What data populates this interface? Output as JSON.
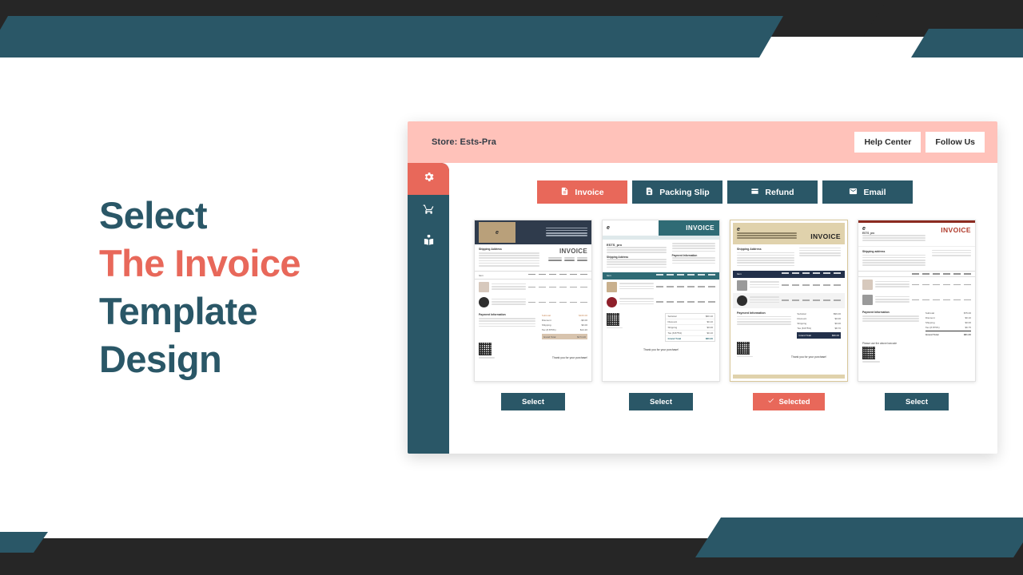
{
  "headline": {
    "line1": "Select",
    "line2": "The Invoice",
    "line3": "Template",
    "line4": "Design"
  },
  "colors": {
    "teal": "#2A5767",
    "coral": "#E8685A",
    "pink_band": "#FFC2BA",
    "charcoal": "#262626",
    "tan": "#E0D2AC",
    "navy": "#22304A",
    "maroon": "#8B2B20"
  },
  "app": {
    "topbar": {
      "store_label": "Store: Ests-Pra",
      "help_center": "Help Center",
      "follow_us": "Follow Us"
    },
    "sidebar": {
      "items": [
        {
          "icon": "gear-icon",
          "active": true
        },
        {
          "icon": "cart-icon",
          "active": false
        },
        {
          "icon": "book-icon",
          "active": false
        }
      ]
    },
    "tabs": [
      {
        "label": "Invoice",
        "icon": "document-icon",
        "active": true
      },
      {
        "label": "Packing Slip",
        "icon": "packing-slip-icon",
        "active": false
      },
      {
        "label": "Refund",
        "icon": "refund-icon",
        "active": false
      },
      {
        "label": "Email",
        "icon": "envelope-icon",
        "active": false
      }
    ],
    "templates": [
      {
        "name": "dark-navy-header",
        "button_label": "Select",
        "selected": false,
        "heading": "INVOICE",
        "store": "ESTS_pro",
        "section_shipping": "Shipping Address",
        "section_payment": "Payment Information",
        "thanks": "Thank you for your purchase!",
        "table_headers": [
          "Item",
          "Qty",
          "Price",
          "Discount",
          "Tax",
          "Tax Amount",
          "Subtotal"
        ],
        "totals": [
          {
            "label": "Subtotal",
            "value": "$160.00"
          },
          {
            "label": "Discount",
            "value": "-$0.00"
          },
          {
            "label": "Shipping",
            "value": "$0.00"
          },
          {
            "label": "Tax (8.875%)",
            "value": "$14.20"
          },
          {
            "label": "Grand Total",
            "value": "$174.20"
          }
        ]
      },
      {
        "name": "teal-banner",
        "button_label": "Select",
        "selected": false,
        "heading": "INVOICE",
        "store": "ESTS_pro",
        "section_shipping": "Shipping Address",
        "section_payment": "Payment Information",
        "thanks": "Thank you for your purchase!",
        "table_headers": [
          "Item",
          "Qty",
          "Price",
          "Discount",
          "Tax",
          "Tax Amount",
          "Subtotal"
        ],
        "totals": [
          {
            "label": "Subtotal",
            "value": "$60.10"
          },
          {
            "label": "Discount",
            "value": "$0.10"
          },
          {
            "label": "Shipping",
            "value": "$0.00"
          },
          {
            "label": "Tax (8.875%)",
            "value": "$0.10"
          },
          {
            "label": "Grand Total",
            "value": "$60.00"
          }
        ]
      },
      {
        "name": "tan-header",
        "button_label": "Selected",
        "selected": true,
        "heading": "INVOICE",
        "store": "ESTS_pro",
        "section_shipping": "Shipping Address",
        "section_payment": "Payment Information",
        "thanks": "Thank you for your purchase!",
        "table_headers": [
          "Item",
          "Qty",
          "Price",
          "Discount",
          "Tax",
          "Tax Amount",
          "Subtotal"
        ],
        "totals": [
          {
            "label": "Subtotal",
            "value": "$96.00"
          },
          {
            "label": "Discount",
            "value": "$0.00"
          },
          {
            "label": "Shipping",
            "value": "$0.00"
          },
          {
            "label": "Tax (8.875%)",
            "value": "$8.70"
          },
          {
            "label": "Grand Total",
            "value": "$96.00"
          }
        ]
      },
      {
        "name": "red-accent",
        "button_label": "Select",
        "selected": false,
        "heading": "INVOICE",
        "store": "ESTS_pro",
        "section_shipping": "Shipping address",
        "section_payment": "Payment Information",
        "thanks": "Please use the above barcode",
        "table_headers": [
          "Qty",
          "Rate",
          "Discount",
          "Tax",
          "Tax Amount",
          "Subtotal"
        ],
        "totals": [
          {
            "label": "Subtotal",
            "value": "$75.00"
          },
          {
            "label": "Discount",
            "value": "$0.10"
          },
          {
            "label": "Shipping",
            "value": "$0.00"
          },
          {
            "label": "Tax (8.875%)",
            "value": "$6.75"
          },
          {
            "label": "Grand Total",
            "value": "$81.00"
          }
        ]
      }
    ]
  }
}
